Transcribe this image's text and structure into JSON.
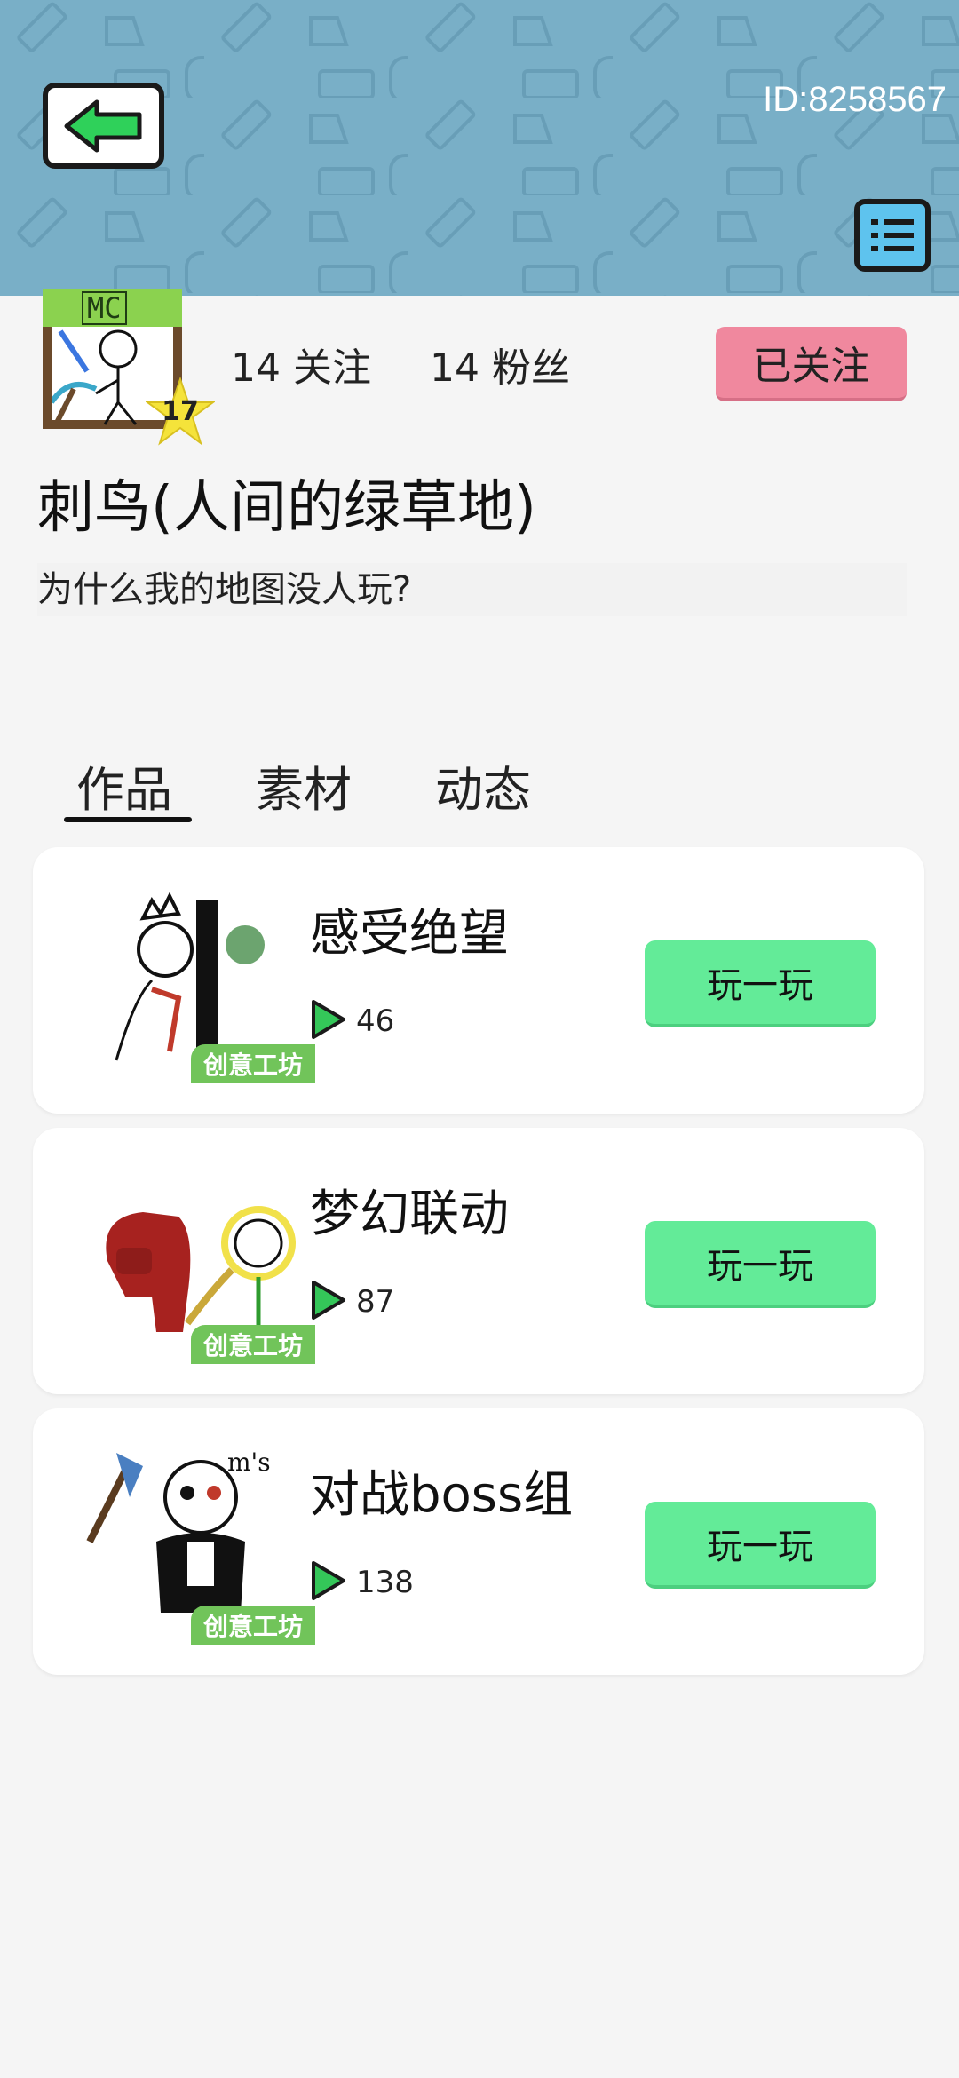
{
  "header": {
    "user_id": "ID:8258567"
  },
  "profile": {
    "avatar_text": "MC",
    "level": "17",
    "following": "14 关注",
    "followers": "14 粉丝",
    "follow_button": "已关注",
    "username": "刺鸟(人间的绿草地)",
    "bio": "为什么我的地图没人玩?"
  },
  "tabs": [
    {
      "label": "作品"
    },
    {
      "label": "素材"
    },
    {
      "label": "动态"
    }
  ],
  "works": [
    {
      "title": "感受绝望",
      "plays": "46",
      "tag": "创意工坊",
      "button": "玩一玩"
    },
    {
      "title": "梦幻联动",
      "plays": "87",
      "tag": "创意工坊",
      "button": "玩一玩"
    },
    {
      "title": "对战boss组",
      "plays": "138",
      "tag": "创意工坊",
      "button": "玩一玩"
    }
  ],
  "colors": {
    "header_bg": "#79afc7",
    "follow_button": "#f0889e",
    "play_button": "#63eb98",
    "workshop_tag": "#71c45a",
    "back_arrow": "#2fd15a"
  },
  "icons": {
    "back": "back-arrow-icon",
    "menu": "list-menu-icon",
    "play": "play-triangle-icon",
    "level": "star-badge-icon"
  }
}
